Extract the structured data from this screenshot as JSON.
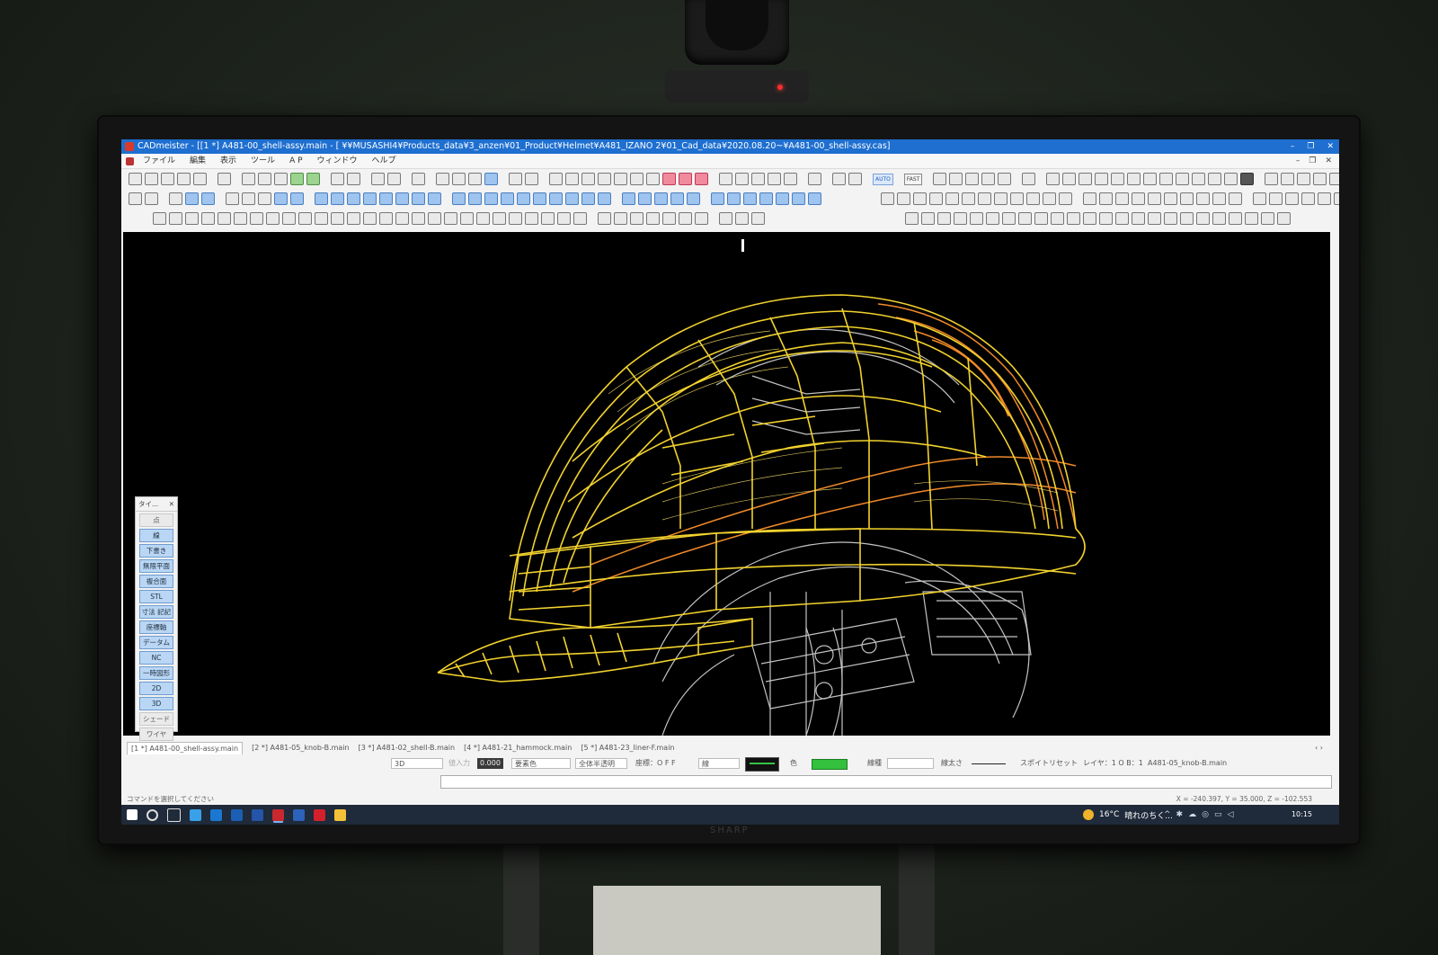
{
  "window": {
    "title": "CADmeister - [[1 *] A481-00_shell-assy.main - [ ¥¥MUSASHI4¥Products_data¥3_anzen¥01_Product¥Helmet¥A481_IZANO 2¥01_Cad_data¥2020.08.20~¥A481-00_shell-assy.cas]",
    "controls": [
      "–",
      "❐",
      "✕"
    ]
  },
  "menu": {
    "items": [
      "ファイル",
      "編集",
      "表示",
      "ツール",
      "A P",
      "ウィンドウ",
      "ヘルプ"
    ],
    "mdi_controls": [
      "–",
      "❐",
      "✕"
    ]
  },
  "toolbar": {
    "auto_label": "AUTO",
    "fast_label": "FAST"
  },
  "side_panel": {
    "title": "タイ...",
    "close": "✕",
    "buttons": [
      "点",
      "線",
      "下書き",
      "無限平面",
      "複合面",
      "STL",
      "寸法 記記",
      "座標軸",
      "データム",
      "NC",
      "一時図形",
      "2D",
      "3D",
      "シェード",
      "ワイヤ"
    ]
  },
  "doc_tabs": {
    "tabs": [
      "[1 *] A481-00_shell-assy.main",
      "[2 *] A481-05_knob-B.main",
      "[3 *] A481-02_shell-B.main",
      "[4 *] A481-21_hammock.main",
      "[5 *] A481-23_liner-F.main"
    ],
    "active": 0,
    "nav": "‹ ›"
  },
  "properties": {
    "mode": "3D",
    "input_label": "値入力",
    "value": "0.000",
    "element_color": "要素色",
    "all_display": "全体半透明",
    "transform": "座標：O F F",
    "line_type": "線",
    "color_label": "色",
    "line_style_label": "線種",
    "line_width_label": "線太さ",
    "spoit": "スポイト",
    "reset": "リセット",
    "layer": "レイヤ：1  O B：1",
    "file": "A481-05_knob-B.main"
  },
  "status": {
    "prompt": "コマンドを選択してください",
    "coords": "X = -240.397,  Y = 35.000,  Z = -102.553"
  },
  "taskbar": {
    "weather_temp": "16°C",
    "weather_text": "晴れのちく...",
    "tray_chevron": "^",
    "clock": "10:15"
  },
  "colors": {
    "titlebar": "#1e6fd0",
    "wire_yellow": "#f2d22e",
    "wire_orange": "#f08a2a",
    "wire_white": "#e6e6e6",
    "viewport_bg": "#000000"
  }
}
